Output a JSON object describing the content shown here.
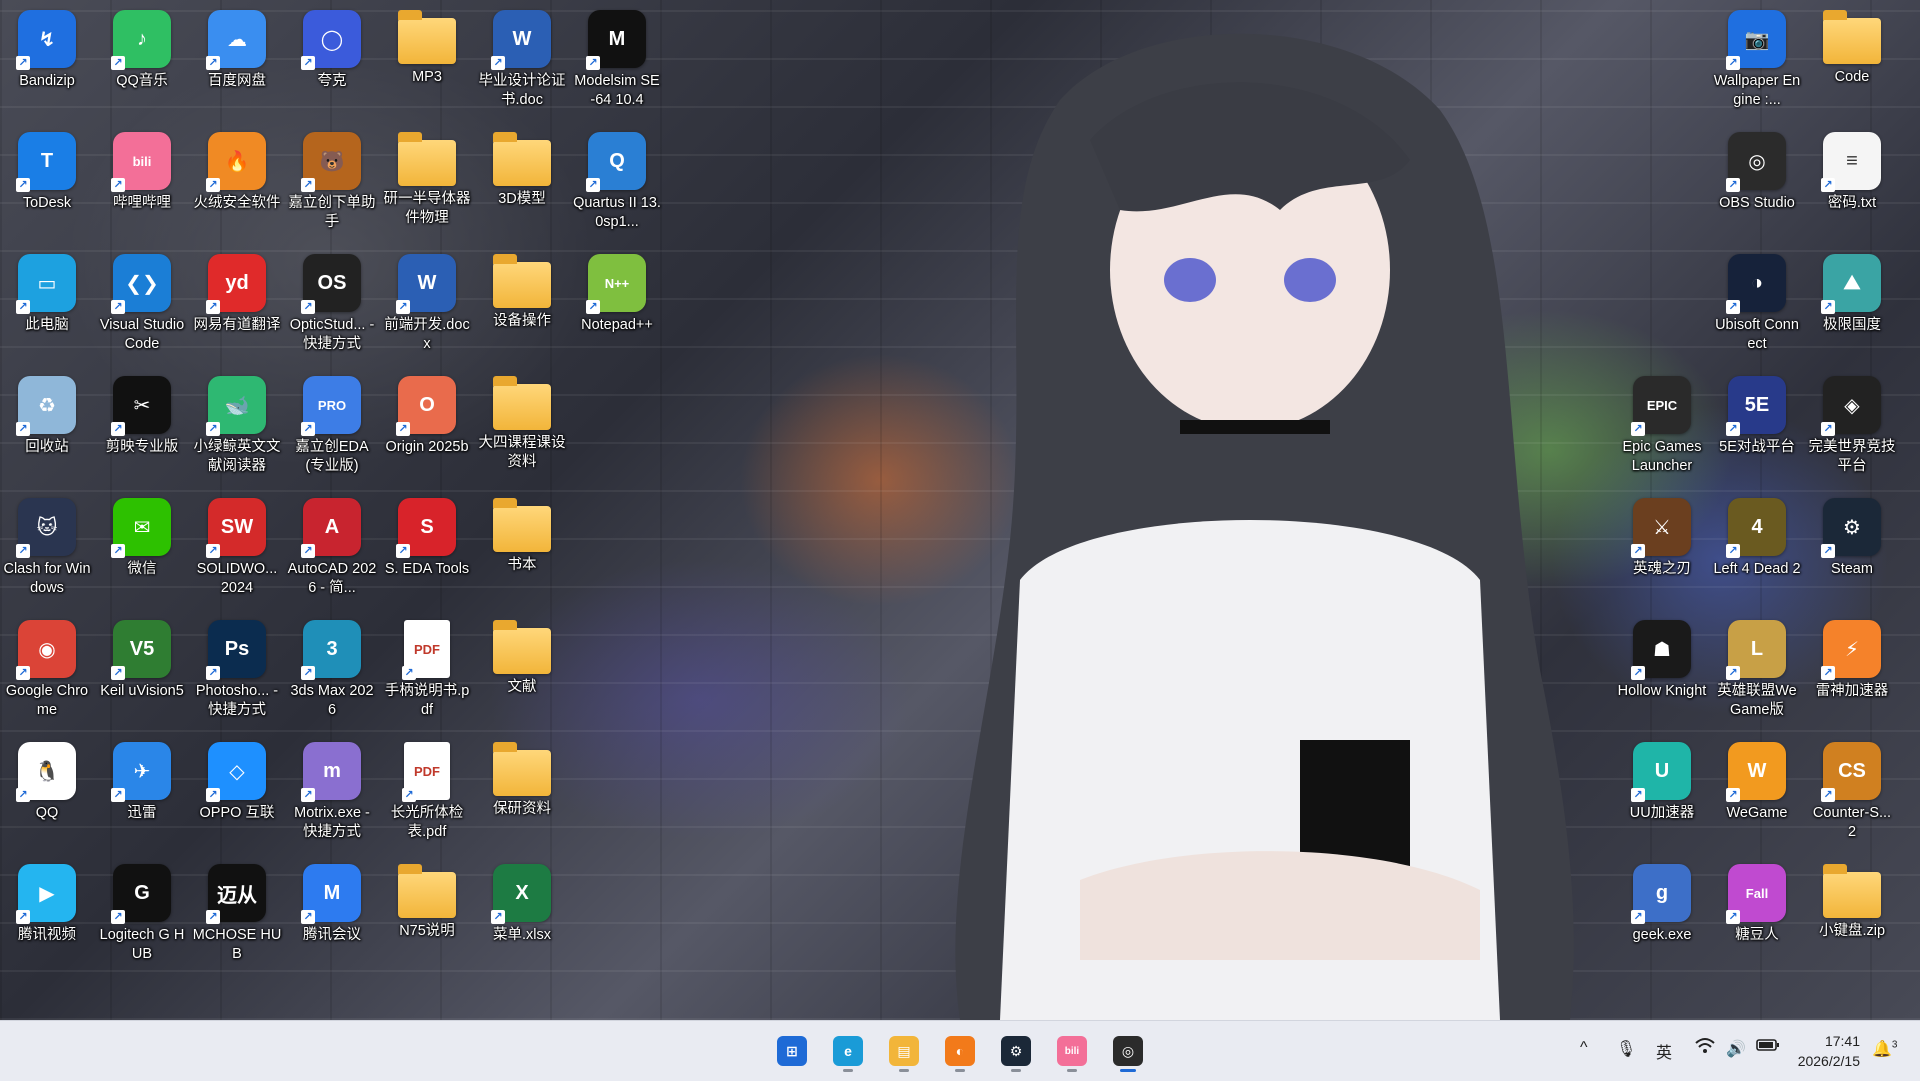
{
  "desktop": {
    "icons": [
      {
        "label": "Bandizip",
        "glyph": "↯",
        "color": "#1f6fe0"
      },
      {
        "label": "QQ音乐",
        "glyph": "♪",
        "color": "#2fbf63"
      },
      {
        "label": "百度网盘",
        "glyph": "☁",
        "color": "#3a8ef0"
      },
      {
        "label": "夸克",
        "glyph": "◯",
        "color": "#3b5bdb"
      },
      {
        "label": "MP3",
        "glyph": "",
        "color": "folder"
      },
      {
        "label": "毕业设计论证书.doc",
        "glyph": "W",
        "color": "#2b5fb4"
      },
      {
        "label": "Modelsim SE-64 10.4",
        "glyph": "M",
        "color": "#111111"
      },
      {
        "label": "ToDesk",
        "glyph": "T",
        "color": "#1a7ee6"
      },
      {
        "label": "哔哩哔哩",
        "glyph": "bili",
        "color": "#f36f98"
      },
      {
        "label": "火绒安全软件",
        "glyph": "🔥",
        "color": "#f08a24"
      },
      {
        "label": "嘉立创下单助手",
        "glyph": "🐻",
        "color": "#b5651d"
      },
      {
        "label": "研一半导体器件物理",
        "glyph": "",
        "color": "folder"
      },
      {
        "label": "3D模型",
        "glyph": "",
        "color": "folder"
      },
      {
        "label": "Quartus II 13.0sp1...",
        "glyph": "Q",
        "color": "#2a7fd4"
      },
      {
        "label": "此电脑",
        "glyph": "▭",
        "color": "#1da1e0"
      },
      {
        "label": "Visual Studio Code",
        "glyph": "❮❯",
        "color": "#1b7ed6"
      },
      {
        "label": "网易有道翻译",
        "glyph": "yd",
        "color": "#e02a2a"
      },
      {
        "label": "OpticStud... - 快捷方式",
        "glyph": "OS",
        "color": "#222222"
      },
      {
        "label": "前端开发.docx",
        "glyph": "W",
        "color": "#2b5fb4"
      },
      {
        "label": "设备操作",
        "glyph": "",
        "color": "folder"
      },
      {
        "label": "Notepad++",
        "glyph": "N++",
        "color": "#7fbf3f"
      },
      {
        "label": "回收站",
        "glyph": "♻",
        "color": "#8fb7d9"
      },
      {
        "label": "剪映专业版",
        "glyph": "✂",
        "color": "#111111"
      },
      {
        "label": "小绿鲸英文文献阅读器",
        "glyph": "🐋",
        "color": "#2eb872"
      },
      {
        "label": "嘉立创EDA(专业版)",
        "glyph": "PRO",
        "color": "#3d7de6"
      },
      {
        "label": "Origin 2025b",
        "glyph": "O",
        "color": "#e96b4c"
      },
      {
        "label": "大四课程课设资料",
        "glyph": "",
        "color": "folder"
      },
      {
        "label": "Clash for Windows",
        "glyph": "🐱",
        "color": "#2a3550"
      },
      {
        "label": "微信",
        "glyph": "✉",
        "color": "#2dc100"
      },
      {
        "label": "SOLIDWO... 2024",
        "glyph": "SW",
        "color": "#d42a2a"
      },
      {
        "label": "AutoCAD 2026 - 简...",
        "glyph": "A",
        "color": "#c8242f"
      },
      {
        "label": "S. EDA Tools",
        "glyph": "S",
        "color": "#d8232a"
      },
      {
        "label": "书本",
        "glyph": "",
        "color": "folder"
      },
      {
        "label": "Google Chrome",
        "glyph": "◉",
        "color": "#db4437"
      },
      {
        "label": "Keil uVision5",
        "glyph": "V5",
        "color": "#2f7d32"
      },
      {
        "label": "Photosho... - 快捷方式",
        "glyph": "Ps",
        "color": "#0b2c4f"
      },
      {
        "label": "3ds Max 2026",
        "glyph": "3",
        "color": "#1f8fb8"
      },
      {
        "label": "手柄说明书.pdf",
        "glyph": "PDF",
        "color": "pdf"
      },
      {
        "label": "文献",
        "glyph": "",
        "color": "folder"
      },
      {
        "label": "QQ",
        "glyph": "🐧",
        "color": "#ffffff"
      },
      {
        "label": "迅雷",
        "glyph": "✈",
        "color": "#2a86e8"
      },
      {
        "label": "OPPO 互联",
        "glyph": "◇",
        "color": "#1e90ff"
      },
      {
        "label": "Motrix.exe - 快捷方式",
        "glyph": "m",
        "color": "#8a6fd0"
      },
      {
        "label": "长光所体检表.pdf",
        "glyph": "PDF",
        "color": "pdf"
      },
      {
        "label": "保研资料",
        "glyph": "",
        "color": "folder"
      },
      {
        "label": "腾讯视频",
        "glyph": "▶",
        "color": "#24b5f0"
      },
      {
        "label": "Logitech G HUB",
        "glyph": "G",
        "color": "#111111"
      },
      {
        "label": "MCHOSE HUB",
        "glyph": "迈从",
        "color": "#111111"
      },
      {
        "label": "腾讯会议",
        "glyph": "M",
        "color": "#2d7bf0"
      },
      {
        "label": "N75说明",
        "glyph": "",
        "color": "folder"
      },
      {
        "label": "菜单.xlsx",
        "glyph": "X",
        "color": "#1d7b43"
      },
      {
        "label": "Wallpaper Engine :...",
        "glyph": "📷",
        "color": "#1f6fe0"
      },
      {
        "label": "Code",
        "glyph": "",
        "color": "folder"
      },
      {
        "label": "OBS Studio",
        "glyph": "◎",
        "color": "#2b2b2b"
      },
      {
        "label": "密码.txt",
        "glyph": "≡",
        "color": "#f5f5f5"
      },
      {
        "label": "Ubisoft Connect",
        "glyph": "◑",
        "color": "#16223a"
      },
      {
        "label": "极限国度",
        "glyph": "⛰",
        "color": "#3aa4a4"
      },
      {
        "label": "Epic Games Launcher",
        "glyph": "EPIC",
        "color": "#2a2a2a"
      },
      {
        "label": "5E对战平台",
        "glyph": "5E",
        "color": "#283a8a"
      },
      {
        "label": "完美世界竞技平台",
        "glyph": "◈",
        "color": "#222222"
      },
      {
        "label": "英魂之刃",
        "glyph": "⚔",
        "color": "#6b3f1f"
      },
      {
        "label": "Left 4 Dead 2",
        "glyph": "4",
        "color": "#6a5a20"
      },
      {
        "label": "Steam",
        "glyph": "⚙",
        "color": "#1b2838"
      },
      {
        "label": "Hollow Knight",
        "glyph": "☗",
        "color": "#1a1a1a"
      },
      {
        "label": "英雄联盟WeGame版",
        "glyph": "L",
        "color": "#c8a046"
      },
      {
        "label": "雷神加速器",
        "glyph": "⚡",
        "color": "#f5822a"
      },
      {
        "label": "UU加速器",
        "glyph": "U",
        "color": "#1fb5a8"
      },
      {
        "label": "WeGame",
        "glyph": "W",
        "color": "#f29a1f"
      },
      {
        "label": "Counter-S... 2",
        "glyph": "CS",
        "color": "#d08020"
      },
      {
        "label": "geek.exe",
        "glyph": "g",
        "color": "#3d6fc8"
      },
      {
        "label": "糖豆人",
        "glyph": "Fall",
        "color": "#c04ad0"
      },
      {
        "label": "小键盘.zip",
        "glyph": "",
        "color": "folder"
      }
    ]
  },
  "taskbar": {
    "apps": [
      {
        "name": "start",
        "glyph": "⊞",
        "color": "#1e6ad6"
      },
      {
        "name": "edge",
        "glyph": "e",
        "color": "#1a9bd7"
      },
      {
        "name": "file-explorer",
        "glyph": "▤",
        "color": "#f2b53a"
      },
      {
        "name": "firefox-like",
        "glyph": "◐",
        "color": "#f27a1a"
      },
      {
        "name": "steam",
        "glyph": "⚙",
        "color": "#1b2838"
      },
      {
        "name": "bilibili",
        "glyph": "bili",
        "color": "#f36f98"
      },
      {
        "name": "obs",
        "glyph": "◎",
        "color": "#2b2b2b"
      }
    ],
    "tray": {
      "chevron": "^",
      "mic": "🎙",
      "ime": "英",
      "wifi": "wifi",
      "volume": "🔊",
      "battery": "▭"
    },
    "clock": {
      "time": "17:41",
      "date": "2026/2/15"
    },
    "notification_count": "3"
  }
}
